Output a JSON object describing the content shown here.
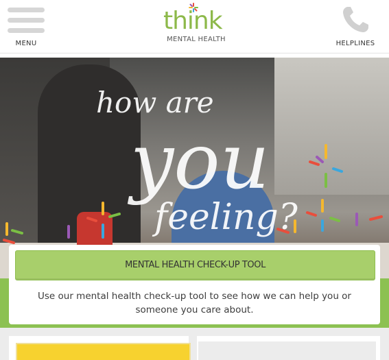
{
  "header": {
    "menu_label": "MENU",
    "logo_text": "think",
    "logo_subtext": "MENTAL HEALTH",
    "helplines_label": "HELPLINES"
  },
  "hero": {
    "script_line_1": "how are",
    "script_line_2": "you",
    "script_line_3": "feeling?"
  },
  "checkup": {
    "button_label": "MENTAL HEALTH CHECK-UP TOOL",
    "description": "Use our mental health check-up tool to see how we can help you or someone you care about."
  },
  "colors": {
    "brand_green": "#8cc152",
    "button_green": "#a8cf6b",
    "tile_yellow": "#f7d22f"
  },
  "icons": [
    "hamburger-icon",
    "phone-icon",
    "logo-star-icon",
    "asterisk-decoration-icon"
  ]
}
